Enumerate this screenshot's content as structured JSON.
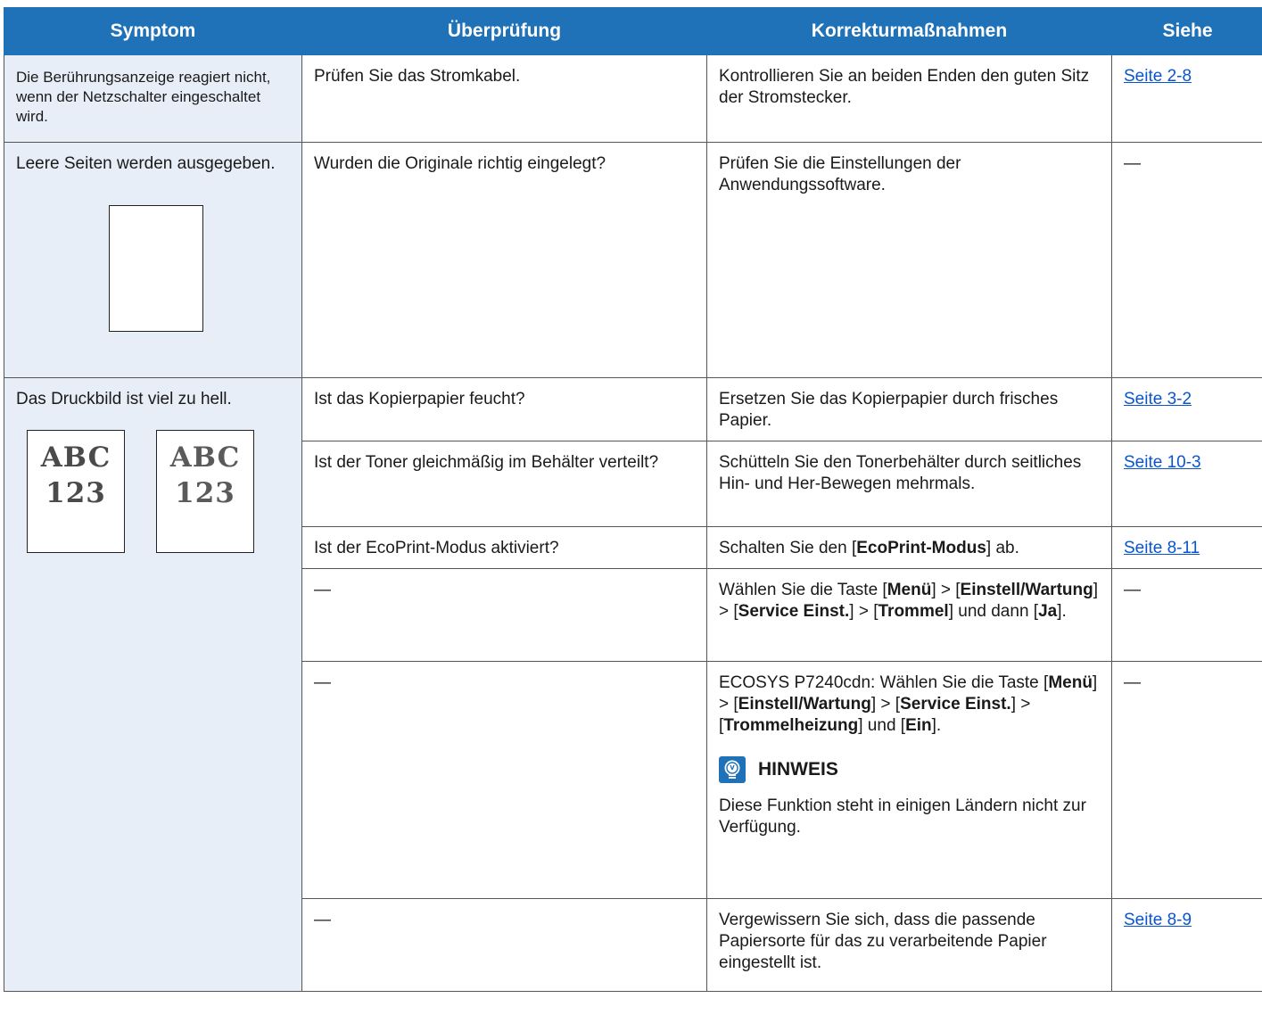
{
  "headers": {
    "symptom": "Symptom",
    "check": "Überprüfung",
    "action": "Korrekturmaßnahmen",
    "see": "Siehe"
  },
  "rows": [
    {
      "symptom": "Die Berührungsanzeige reagiert nicht, wenn der Netzschalter eingeschaltet wird.",
      "check": "Prüfen Sie das Stromkabel.",
      "action": "Kontrollieren Sie an beiden Enden den guten Sitz der Stromstecker.",
      "see": "Seite 2-8"
    },
    {
      "symptom": "Leere Seiten werden ausgegeben.",
      "check": "Wurden die Originale richtig eingelegt?",
      "action": "Prüfen Sie die Einstellungen der Anwendungssoftware.",
      "see": "—"
    },
    {
      "symptom": "Das Druckbild ist viel zu hell.",
      "sample_text_1": "ABC",
      "sample_text_2": "123",
      "check": "Ist das Kopierpapier feucht?",
      "action": "Ersetzen Sie das Kopierpapier durch frisches Papier.",
      "see": "Seite 3-2"
    },
    {
      "check": "Ist der Toner gleichmäßig im Behälter verteilt?",
      "action": "Schütteln Sie den Tonerbehälter durch seitliches Hin- und Her-Bewegen mehrmals.",
      "see": "Seite 10-3"
    },
    {
      "check": "Ist der EcoPrint-Modus aktiviert?",
      "action_pre": "Schalten Sie den [",
      "action_bold": "EcoPrint-Modus",
      "action_post": "] ab.",
      "see": "Seite 8-11"
    },
    {
      "check": "—",
      "action_parts": [
        "Wählen Sie die Taste [",
        "Menü",
        "] > [",
        "Einstell/Wartung",
        "] > [",
        "Service Einst.",
        "] > [",
        "Trommel",
        "] und dann [",
        "Ja",
        "]."
      ],
      "see": "—"
    },
    {
      "check": "—",
      "action_parts": [
        "ECOSYS P7240cdn: Wählen Sie die Taste [",
        "Menü",
        "] > [",
        "Einstell/Wartung",
        "] > [",
        "Service Einst.",
        "] > [",
        "Trommelheizung",
        "] und [",
        "Ein",
        "]."
      ],
      "note_title": "HINWEIS",
      "note_text": "Diese Funktion steht in einigen Ländern nicht zur Verfügung.",
      "see": "—"
    },
    {
      "check": "—",
      "action": "Vergewissern Sie sich, dass die passende Papiersorte für das zu verarbeitende Papier eingestellt ist.",
      "see": "Seite 8-9"
    }
  ],
  "colors": {
    "header": "#1f72b8",
    "symptom_bg": "#e8eef8",
    "link": "#0a55cc"
  },
  "icons": {
    "note": "lightbulb-note-icon"
  }
}
